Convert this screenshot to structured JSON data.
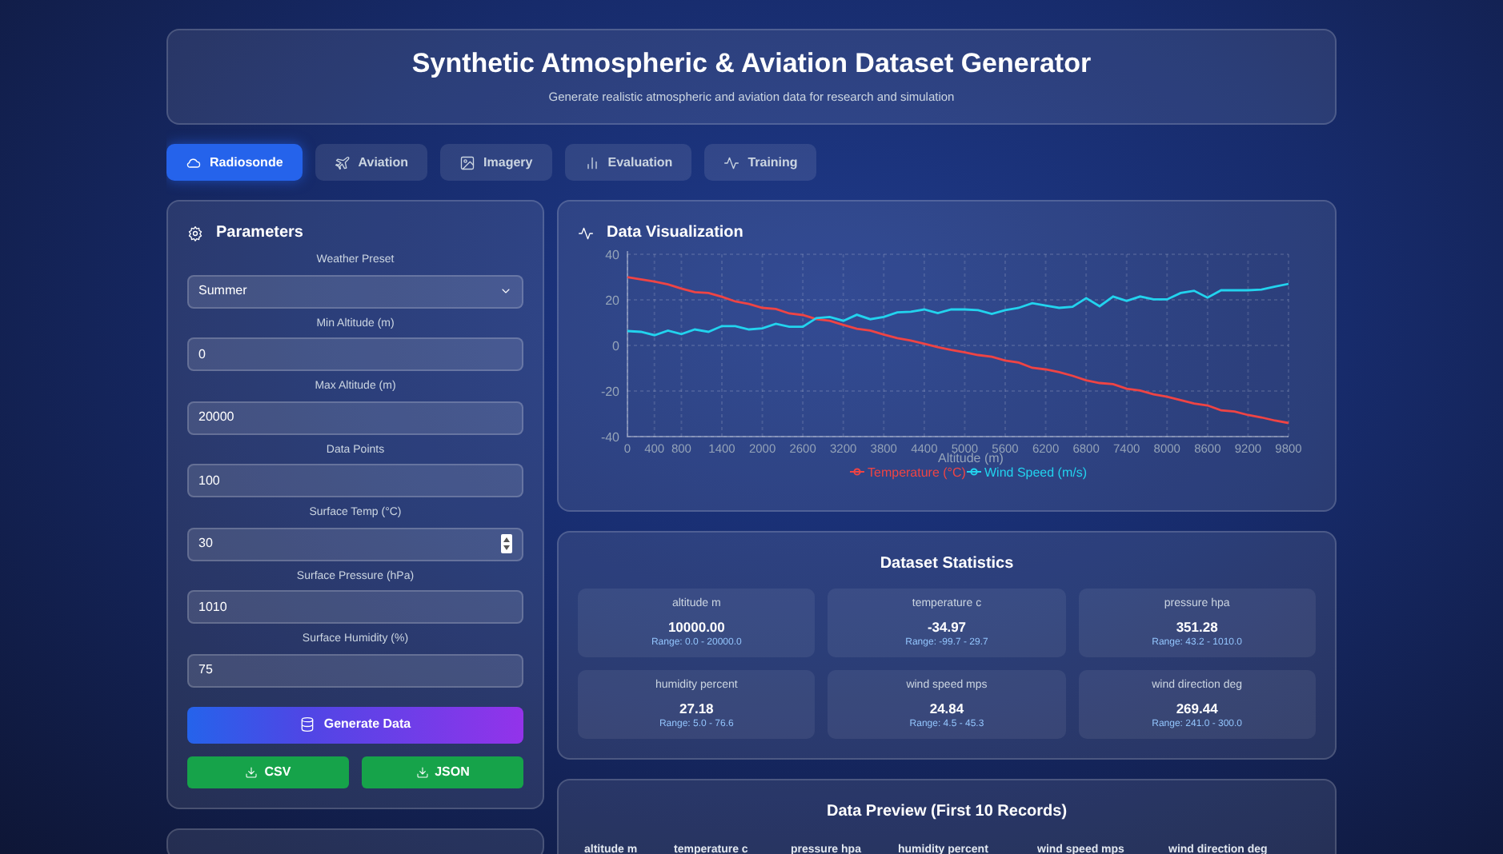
{
  "header": {
    "title": "Synthetic Atmospheric & Aviation Dataset Generator",
    "subtitle": "Generate realistic atmospheric and aviation data for research and simulation"
  },
  "tabs": [
    {
      "label": "Radiosonde",
      "selected": true
    },
    {
      "label": "Aviation",
      "selected": false
    },
    {
      "label": "Imagery",
      "selected": false
    },
    {
      "label": "Evaluation",
      "selected": false
    },
    {
      "label": "Training",
      "selected": false
    }
  ],
  "parameters": {
    "title": "Parameters",
    "fields": [
      {
        "kind": "select",
        "label": "Weather Preset",
        "value": "Summer"
      },
      {
        "kind": "input",
        "label": "Min Altitude (m)",
        "value": "0"
      },
      {
        "kind": "input",
        "label": "Max Altitude (m)",
        "value": "20000"
      },
      {
        "kind": "input",
        "label": "Data Points",
        "value": "100"
      },
      {
        "kind": "spinner",
        "label": "Surface Temp (°C)",
        "value": "30"
      },
      {
        "kind": "input",
        "label": "Surface Pressure (hPa)",
        "value": "1010"
      },
      {
        "kind": "input",
        "label": "Surface Humidity (%)",
        "value": "75"
      }
    ],
    "generate_button": "Generate Data",
    "export_buttons": [
      "CSV",
      "JSON"
    ]
  },
  "visualization": {
    "title": "Data Visualization",
    "chart_data": {
      "type": "line",
      "xlabel": "Altitude (m)",
      "x": [
        0,
        200,
        400,
        600,
        800,
        1000,
        1200,
        1400,
        1600,
        1800,
        2000,
        2200,
        2400,
        2600,
        2800,
        3000,
        3200,
        3400,
        3600,
        3800,
        4000,
        4200,
        4400,
        4600,
        4800,
        5000,
        5200,
        5400,
        5600,
        5800,
        6000,
        6200,
        6400,
        6600,
        6800,
        7000,
        7200,
        7400,
        7600,
        7800,
        8000,
        8200,
        8400,
        8600,
        8800,
        9000,
        9200,
        9400,
        9600,
        9800
      ],
      "series": [
        {
          "name": "Temperature (°C)",
          "color": "#ef4444",
          "values": [
            30,
            29,
            28,
            26.8,
            25,
            23.4,
            23,
            21.3,
            19.3,
            18.2,
            16.5,
            16,
            14,
            13.3,
            11.5,
            10.8,
            9,
            7.3,
            6.5,
            4.8,
            3.2,
            2.2,
            0.8,
            -0.8,
            -2,
            -3,
            -4.2,
            -5,
            -6.6,
            -7.5,
            -9.8,
            -10.5,
            -11.7,
            -13.3,
            -15.3,
            -16.5,
            -17,
            -19,
            -19.8,
            -21.5,
            -22.5,
            -24,
            -25.5,
            -26.3,
            -28.5,
            -29,
            -30.5,
            -31.6,
            -33,
            -34
          ]
        },
        {
          "name": "Wind Speed (m/s)",
          "color": "#22d3ee",
          "values": [
            6.3,
            6,
            4.5,
            6.5,
            5,
            7,
            6,
            8.5,
            8.5,
            7,
            7.5,
            9.5,
            8.2,
            8.2,
            12,
            12.5,
            10.8,
            13.5,
            11.5,
            12.5,
            14.5,
            14.8,
            15.8,
            14.2,
            15.8,
            15.8,
            15.5,
            13.8,
            15.5,
            16.5,
            18.5,
            17.5,
            16.5,
            17,
            20.8,
            17.2,
            21.5,
            19.5,
            21.5,
            20.2,
            20.2,
            23,
            24,
            21,
            24.2,
            24.2,
            24.2,
            24.5,
            25.8,
            27
          ]
        }
      ],
      "xlim": [
        0,
        9800
      ],
      "grid": true,
      "legend": true,
      "ylim": [
        -40,
        40
      ],
      "yticks": [
        -40,
        -20,
        0,
        20,
        40
      ],
      "xticks": [
        0,
        400,
        800,
        1400,
        2000,
        2600,
        3200,
        3800,
        4400,
        5000,
        5600,
        6200,
        6800,
        7400,
        8000,
        8600,
        9200,
        9800
      ]
    }
  },
  "statistics": {
    "title": "Dataset Statistics",
    "items": [
      {
        "label": "altitude m",
        "value": "10000.00",
        "range": "Range: 0.0 - 20000.0"
      },
      {
        "label": "temperature c",
        "value": "-34.97",
        "range": "Range: -99.7 - 29.7"
      },
      {
        "label": "pressure hpa",
        "value": "351.28",
        "range": "Range: 43.2 - 1010.0"
      },
      {
        "label": "humidity percent",
        "value": "27.18",
        "range": "Range: 5.0 - 76.6"
      },
      {
        "label": "wind speed mps",
        "value": "24.84",
        "range": "Range: 4.5 - 45.3"
      },
      {
        "label": "wind direction deg",
        "value": "269.44",
        "range": "Range: 241.0 - 300.0"
      }
    ]
  },
  "preview": {
    "title": "Data Preview (First 10 Records)",
    "columns": [
      "altitude m",
      "temperature c",
      "pressure hpa",
      "humidity percent",
      "wind speed mps",
      "wind direction deg"
    ]
  }
}
